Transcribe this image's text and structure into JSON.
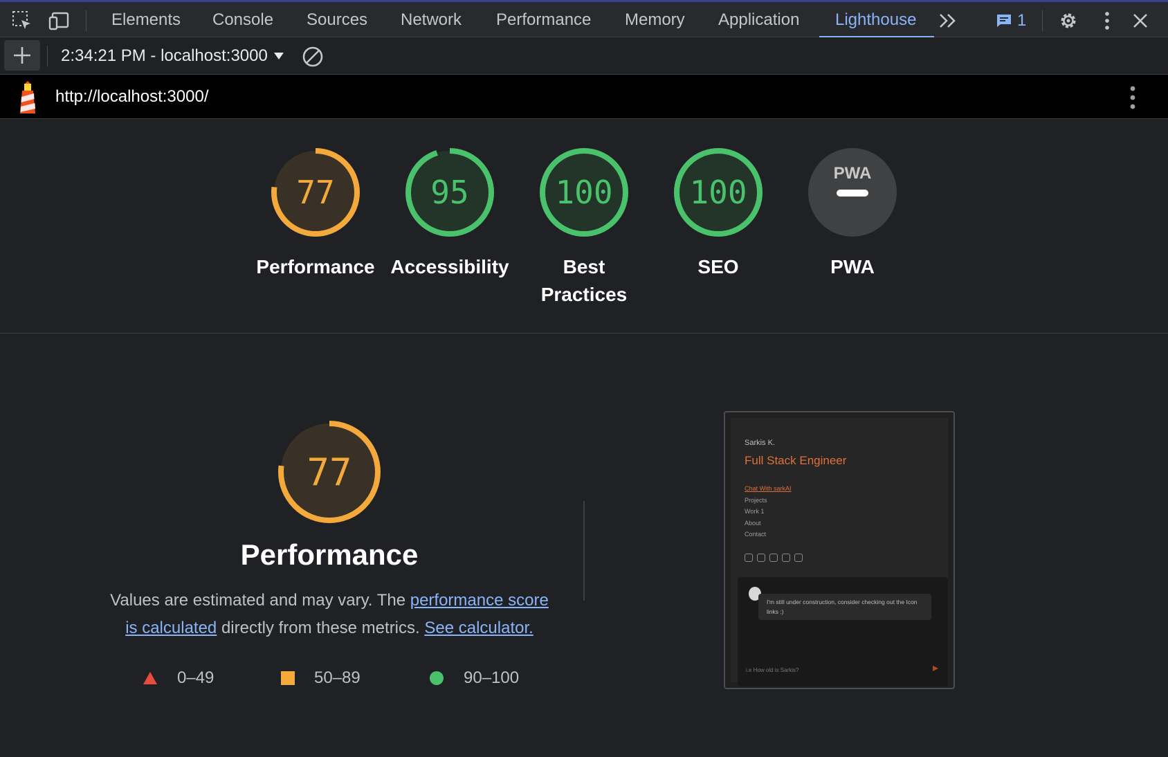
{
  "tabs": [
    {
      "label": "Elements"
    },
    {
      "label": "Console"
    },
    {
      "label": "Sources"
    },
    {
      "label": "Network"
    },
    {
      "label": "Performance"
    },
    {
      "label": "Memory"
    },
    {
      "label": "Application"
    },
    {
      "label": "Lighthouse"
    }
  ],
  "active_tab": "Lighthouse",
  "issues_count": "1",
  "toolbar": {
    "report_label": "2:34:21 PM - localhost:3000"
  },
  "url": "http://localhost:3000/",
  "scores": [
    {
      "label_line1": "Performance",
      "label_line2": "",
      "value": "77",
      "fraction": 0.77,
      "color": "#f4a93c",
      "bg": "#3a3126"
    },
    {
      "label_line1": "Accessibility",
      "label_line2": "",
      "value": "95",
      "fraction": 0.95,
      "color": "#4ac26b",
      "bg": "#233429"
    },
    {
      "label_line1": "Best",
      "label_line2": "Practices",
      "value": "100",
      "fraction": 1.0,
      "color": "#4ac26b",
      "bg": "#233429"
    },
    {
      "label_line1": "SEO",
      "label_line2": "",
      "value": "100",
      "fraction": 1.0,
      "color": "#4ac26b",
      "bg": "#233429"
    },
    {
      "label_line1": "PWA",
      "label_line2": "",
      "value": "PWA",
      "fraction": 0,
      "color": "#ffffff",
      "bg": "#404143"
    }
  ],
  "performance": {
    "score": "77",
    "fraction": 0.77,
    "title": "Performance",
    "desc_part1": "Values are estimated and may vary. The ",
    "link1": "performance score is calculated",
    "desc_part2": " directly from these metrics. ",
    "link2": "See calculator.",
    "legend": [
      {
        "range": "0–49",
        "color": "#e94b3c",
        "shape": "triangle"
      },
      {
        "range": "50–89",
        "color": "#f4a93c",
        "shape": "square"
      },
      {
        "range": "90–100",
        "color": "#4ac26b",
        "shape": "circle"
      }
    ]
  },
  "thumbnail": {
    "name": "Sarkis K.",
    "role": "Full Stack Engineer",
    "nav": [
      "Chat With sarkAI",
      "Projects",
      "Work 1",
      "About",
      "Contact"
    ],
    "chat_message": "I'm still under construction, consider checking out the Icon links :)",
    "input_placeholder": "i.e How old is Sarkis?"
  }
}
